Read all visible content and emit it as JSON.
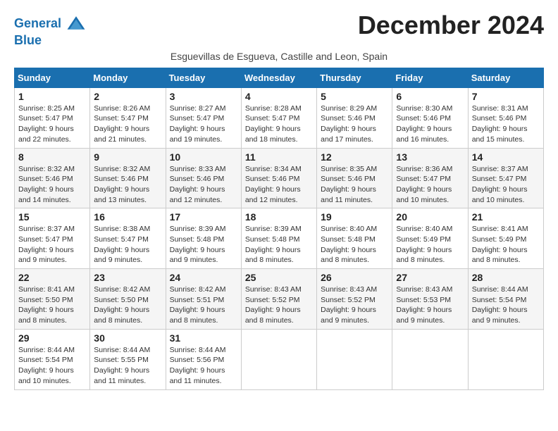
{
  "logo": {
    "line1": "General",
    "line2": "Blue"
  },
  "title": "December 2024",
  "subtitle": "Esguevillas de Esgueva, Castille and Leon, Spain",
  "days_of_week": [
    "Sunday",
    "Monday",
    "Tuesday",
    "Wednesday",
    "Thursday",
    "Friday",
    "Saturday"
  ],
  "weeks": [
    [
      {
        "day": "1",
        "sunrise": "8:25 AM",
        "sunset": "5:47 PM",
        "daylight": "9 hours and 22 minutes."
      },
      {
        "day": "2",
        "sunrise": "8:26 AM",
        "sunset": "5:47 PM",
        "daylight": "9 hours and 21 minutes."
      },
      {
        "day": "3",
        "sunrise": "8:27 AM",
        "sunset": "5:47 PM",
        "daylight": "9 hours and 19 minutes."
      },
      {
        "day": "4",
        "sunrise": "8:28 AM",
        "sunset": "5:47 PM",
        "daylight": "9 hours and 18 minutes."
      },
      {
        "day": "5",
        "sunrise": "8:29 AM",
        "sunset": "5:46 PM",
        "daylight": "9 hours and 17 minutes."
      },
      {
        "day": "6",
        "sunrise": "8:30 AM",
        "sunset": "5:46 PM",
        "daylight": "9 hours and 16 minutes."
      },
      {
        "day": "7",
        "sunrise": "8:31 AM",
        "sunset": "5:46 PM",
        "daylight": "9 hours and 15 minutes."
      }
    ],
    [
      {
        "day": "8",
        "sunrise": "8:32 AM",
        "sunset": "5:46 PM",
        "daylight": "9 hours and 14 minutes."
      },
      {
        "day": "9",
        "sunrise": "8:32 AM",
        "sunset": "5:46 PM",
        "daylight": "9 hours and 13 minutes."
      },
      {
        "day": "10",
        "sunrise": "8:33 AM",
        "sunset": "5:46 PM",
        "daylight": "9 hours and 12 minutes."
      },
      {
        "day": "11",
        "sunrise": "8:34 AM",
        "sunset": "5:46 PM",
        "daylight": "9 hours and 12 minutes."
      },
      {
        "day": "12",
        "sunrise": "8:35 AM",
        "sunset": "5:46 PM",
        "daylight": "9 hours and 11 minutes."
      },
      {
        "day": "13",
        "sunrise": "8:36 AM",
        "sunset": "5:47 PM",
        "daylight": "9 hours and 10 minutes."
      },
      {
        "day": "14",
        "sunrise": "8:37 AM",
        "sunset": "5:47 PM",
        "daylight": "9 hours and 10 minutes."
      }
    ],
    [
      {
        "day": "15",
        "sunrise": "8:37 AM",
        "sunset": "5:47 PM",
        "daylight": "9 hours and 9 minutes."
      },
      {
        "day": "16",
        "sunrise": "8:38 AM",
        "sunset": "5:47 PM",
        "daylight": "9 hours and 9 minutes."
      },
      {
        "day": "17",
        "sunrise": "8:39 AM",
        "sunset": "5:48 PM",
        "daylight": "9 hours and 9 minutes."
      },
      {
        "day": "18",
        "sunrise": "8:39 AM",
        "sunset": "5:48 PM",
        "daylight": "9 hours and 8 minutes."
      },
      {
        "day": "19",
        "sunrise": "8:40 AM",
        "sunset": "5:48 PM",
        "daylight": "9 hours and 8 minutes."
      },
      {
        "day": "20",
        "sunrise": "8:40 AM",
        "sunset": "5:49 PM",
        "daylight": "9 hours and 8 minutes."
      },
      {
        "day": "21",
        "sunrise": "8:41 AM",
        "sunset": "5:49 PM",
        "daylight": "9 hours and 8 minutes."
      }
    ],
    [
      {
        "day": "22",
        "sunrise": "8:41 AM",
        "sunset": "5:50 PM",
        "daylight": "9 hours and 8 minutes."
      },
      {
        "day": "23",
        "sunrise": "8:42 AM",
        "sunset": "5:50 PM",
        "daylight": "9 hours and 8 minutes."
      },
      {
        "day": "24",
        "sunrise": "8:42 AM",
        "sunset": "5:51 PM",
        "daylight": "9 hours and 8 minutes."
      },
      {
        "day": "25",
        "sunrise": "8:43 AM",
        "sunset": "5:52 PM",
        "daylight": "9 hours and 8 minutes."
      },
      {
        "day": "26",
        "sunrise": "8:43 AM",
        "sunset": "5:52 PM",
        "daylight": "9 hours and 9 minutes."
      },
      {
        "day": "27",
        "sunrise": "8:43 AM",
        "sunset": "5:53 PM",
        "daylight": "9 hours and 9 minutes."
      },
      {
        "day": "28",
        "sunrise": "8:44 AM",
        "sunset": "5:54 PM",
        "daylight": "9 hours and 9 minutes."
      }
    ],
    [
      {
        "day": "29",
        "sunrise": "8:44 AM",
        "sunset": "5:54 PM",
        "daylight": "9 hours and 10 minutes."
      },
      {
        "day": "30",
        "sunrise": "8:44 AM",
        "sunset": "5:55 PM",
        "daylight": "9 hours and 11 minutes."
      },
      {
        "day": "31",
        "sunrise": "8:44 AM",
        "sunset": "5:56 PM",
        "daylight": "9 hours and 11 minutes."
      },
      null,
      null,
      null,
      null
    ]
  ],
  "labels": {
    "sunrise": "Sunrise:",
    "sunset": "Sunset:",
    "daylight": "Daylight:"
  }
}
